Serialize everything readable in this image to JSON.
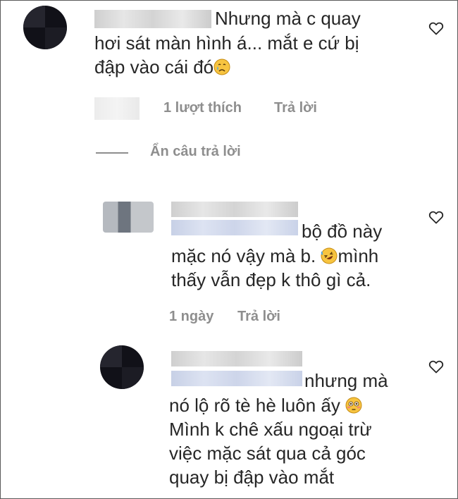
{
  "comments": [
    {
      "text_lines": [
        "Nhưng mà c quay",
        "hơi sát màn hình á... mắt e cứ bị",
        "đập vào cái đó"
      ],
      "emoji": "crying-face",
      "likes": "1 lượt thích",
      "reply": "Trả lời",
      "hide_replies": "Ẩn câu trả lời"
    },
    {
      "text_lines": [
        "bộ đồ này",
        "mặc nó vậy mà b.",
        "mình",
        "thấy vẫn đẹp k thô gì cả."
      ],
      "emoji": "rofl-face",
      "time": "1 ngày",
      "reply": "Trả lời"
    },
    {
      "text_lines": [
        "nhưng mà",
        "nó lộ rõ tè hè luôn ấy",
        "Mình k chê xấu ngoại trừ",
        "việc mặc sát qua cả góc",
        "quay bị đập vào mắt"
      ],
      "emoji": "flushed-face"
    }
  ],
  "colors": {
    "text": "#262626",
    "meta": "#8e8e8e",
    "background": "#ffffff"
  },
  "icons": [
    "heart-outline-icon"
  ]
}
